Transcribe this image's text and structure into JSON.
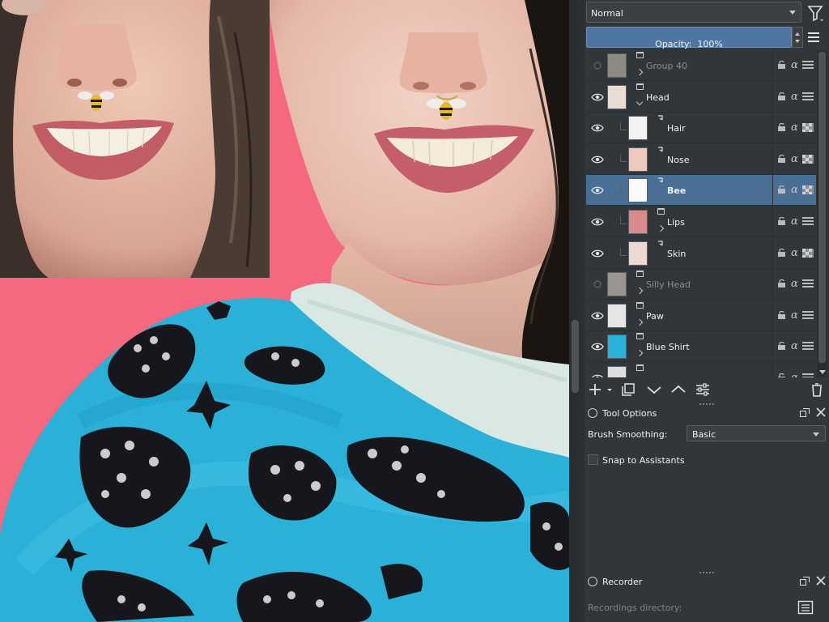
{
  "blend_mode": {
    "value": "Normal"
  },
  "opacity": {
    "label": "Opacity:",
    "value": "100%"
  },
  "layers": [
    {
      "name": "Group 40",
      "type": "group",
      "visible": false,
      "expanded": false,
      "indent": 0,
      "selected": false,
      "thumb_color": "#8d8a83"
    },
    {
      "name": "Head",
      "type": "group",
      "visible": true,
      "expanded": true,
      "indent": 0,
      "selected": false,
      "thumb_color": "#e9ded4"
    },
    {
      "name": "Hair",
      "type": "paint",
      "clipped": true,
      "visible": true,
      "indent": 1,
      "selected": false,
      "thumb_color": "#f2f2f2"
    },
    {
      "name": "Nose",
      "type": "paint",
      "clipped": true,
      "visible": true,
      "indent": 1,
      "selected": false,
      "thumb_color": "#f0c9bd"
    },
    {
      "name": "Bee",
      "type": "paint",
      "clipped": true,
      "visible": true,
      "indent": 1,
      "selected": true,
      "thumb_color": "#fafafa"
    },
    {
      "name": "Lips",
      "type": "group",
      "visible": true,
      "expanded": false,
      "indent": 1,
      "selected": false,
      "thumb_color": "#d98a8e"
    },
    {
      "name": "Skin",
      "type": "paint",
      "clipped": true,
      "visible": true,
      "indent": 1,
      "selected": false,
      "thumb_color": "#ecdad2"
    },
    {
      "name": "Silly Head",
      "type": "group",
      "visible": false,
      "expanded": false,
      "indent": 0,
      "selected": false,
      "thumb_color": "#9a9590"
    },
    {
      "name": "Paw",
      "type": "group",
      "visible": true,
      "expanded": false,
      "indent": 0,
      "selected": false,
      "thumb_color": "#e6e6e6"
    },
    {
      "name": "Blue Shirt",
      "type": "group",
      "visible": true,
      "expanded": false,
      "indent": 0,
      "selected": false,
      "thumb_color": "#2bb0d8"
    },
    {
      "name": "",
      "type": "group",
      "visible": true,
      "expanded": false,
      "indent": 0,
      "selected": false,
      "thumb_color": "#dddddd"
    }
  ],
  "tool_options": {
    "title": "Tool Options",
    "brush_smoothing_label": "Brush Smoothing:",
    "brush_smoothing_value": "Basic",
    "snap_label": "Snap to Assistants",
    "snap_checked": false
  },
  "recorder": {
    "title": "Recorder",
    "directory_label": "Recordings directory:"
  },
  "colors": {
    "accent": "#4f76a0",
    "selected_row": "#4a6f95",
    "canvas_background": "#f4697f",
    "shirt": "#2bb0d8",
    "panel": "#31363b"
  },
  "icons": [
    "filter-icon",
    "menu-icon",
    "eye-icon",
    "lock-icon",
    "alpha-lock-icon",
    "inherit-alpha-icon",
    "add-layer-icon",
    "duplicate-icon",
    "move-down-icon",
    "move-up-icon",
    "layer-properties-icon",
    "delete-icon",
    "float-icon",
    "close-icon",
    "folder-icon"
  ]
}
